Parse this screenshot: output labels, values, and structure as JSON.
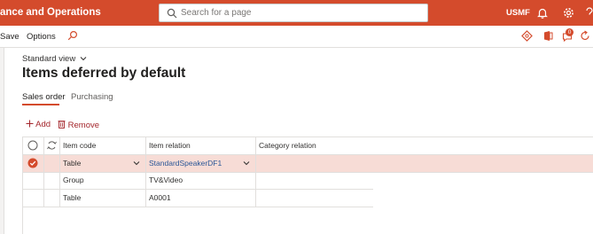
{
  "topbar": {
    "app_title": "ance and Operations",
    "search_placeholder": "Search for a page",
    "company": "USMF"
  },
  "actionpane": {
    "save_label": "Save",
    "options_label": "Options"
  },
  "page": {
    "view_label": "Standard view",
    "title": "Items deferred by default"
  },
  "tabs": [
    {
      "label": "Sales order",
      "active": true
    },
    {
      "label": "Purchasing",
      "active": false
    }
  ],
  "grid_actions": {
    "add_label": "Add",
    "remove_label": "Remove"
  },
  "grid": {
    "columns": [
      "Item code",
      "Item relation",
      "Category relation"
    ],
    "rows": [
      {
        "item_code": "Table",
        "item_relation": "StandardSpeakerDF1",
        "category_relation": "",
        "selected": true
      },
      {
        "item_code": "Group",
        "item_relation": "TV&Video",
        "category_relation": "",
        "selected": false
      },
      {
        "item_code": "Table",
        "item_relation": "A0001",
        "category_relation": "",
        "selected": false
      }
    ]
  },
  "notifications": {
    "badge_count": "0"
  },
  "colors": {
    "brand": "#d44b2c",
    "selected_row": "#f7dcd6",
    "link": "#2b5797",
    "action": "#a4262c"
  }
}
